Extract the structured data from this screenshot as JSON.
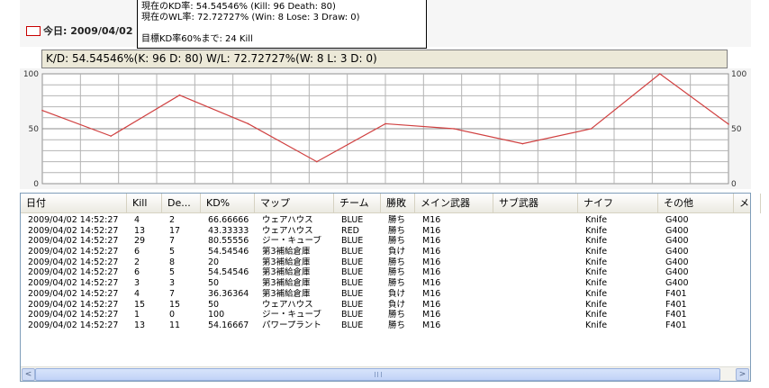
{
  "legend": {
    "date_label": "今日: 2009/04/02"
  },
  "tooltip": {
    "line1": "現在のKD率: 54.54546% (Kill: 96 Death: 80)",
    "line2": "現在のWL率: 72.72727% (Win: 8 Lose: 3 Draw: 0)",
    "line3": "目標KD率60%まで: 24 Kill"
  },
  "stats_bar": {
    "text": "K/D: 54.54546%(K: 96 D: 80) W/L: 72.72727%(W: 8 L: 3 D: 0)"
  },
  "chart_data": {
    "type": "line",
    "ylim": [
      0,
      100
    ],
    "y_ticks": [
      "100",
      "50",
      "0"
    ],
    "series": [
      {
        "color": "#d04040",
        "values": [
          66.66666,
          43.33333,
          80.55556,
          54.54546,
          20,
          54.54546,
          50,
          36.36364,
          50,
          100,
          54.16667
        ]
      }
    ],
    "grid": true
  },
  "grid": {
    "columns": [
      "日付",
      "Kill",
      "De...",
      "KD%",
      "マップ",
      "チーム",
      "勝敗",
      "メイン武器",
      "サブ武器",
      "ナイフ",
      "その他",
      "メ"
    ],
    "rows": [
      [
        "2009/04/02 14:52:27",
        "4",
        "2",
        "66.66666",
        "ウェアハウス",
        "BLUE",
        "勝ち",
        "M16",
        "",
        "Knife",
        "G400"
      ],
      [
        "2009/04/02 14:52:27",
        "13",
        "17",
        "43.33333",
        "ウェアハウス",
        "RED",
        "勝ち",
        "M16",
        "",
        "Knife",
        "G400"
      ],
      [
        "2009/04/02 14:52:27",
        "29",
        "7",
        "80.55556",
        "ジー・キューブ",
        "BLUE",
        "勝ち",
        "M16",
        "",
        "Knife",
        "G400"
      ],
      [
        "2009/04/02 14:52:27",
        "6",
        "5",
        "54.54546",
        "第3補給倉庫",
        "BLUE",
        "負け",
        "M16",
        "",
        "Knife",
        "G400"
      ],
      [
        "2009/04/02 14:52:27",
        "2",
        "8",
        "20",
        "第3補給倉庫",
        "BLUE",
        "勝ち",
        "M16",
        "",
        "Knife",
        "G400"
      ],
      [
        "2009/04/02 14:52:27",
        "6",
        "5",
        "54.54546",
        "第3補給倉庫",
        "BLUE",
        "勝ち",
        "M16",
        "",
        "Knife",
        "G400"
      ],
      [
        "2009/04/02 14:52:27",
        "3",
        "3",
        "50",
        "第3補給倉庫",
        "BLUE",
        "勝ち",
        "M16",
        "",
        "Knife",
        "G400"
      ],
      [
        "2009/04/02 14:52:27",
        "4",
        "7",
        "36.36364",
        "第3補給倉庫",
        "BLUE",
        "負け",
        "M16",
        "",
        "Knife",
        "F401"
      ],
      [
        "2009/04/02 14:52:27",
        "15",
        "15",
        "50",
        "ウェアハウス",
        "BLUE",
        "負け",
        "M16",
        "",
        "Knife",
        "F401"
      ],
      [
        "2009/04/02 14:52:27",
        "1",
        "0",
        "100",
        "ジー・キューブ",
        "BLUE",
        "勝ち",
        "M16",
        "",
        "Knife",
        "F401"
      ],
      [
        "2009/04/02 14:52:27",
        "13",
        "11",
        "54.16667",
        "パワープラント",
        "BLUE",
        "勝ち",
        "M16",
        "",
        "Knife",
        "F401"
      ]
    ]
  },
  "scrollbar": {
    "left_arrow": "<",
    "right_arrow": ">"
  },
  "colors": {
    "line": "#d04040",
    "grid": "#b4b4b4",
    "stat_bar_bg": "#ece9d8",
    "scroll_accent": "#c1d3f7"
  }
}
